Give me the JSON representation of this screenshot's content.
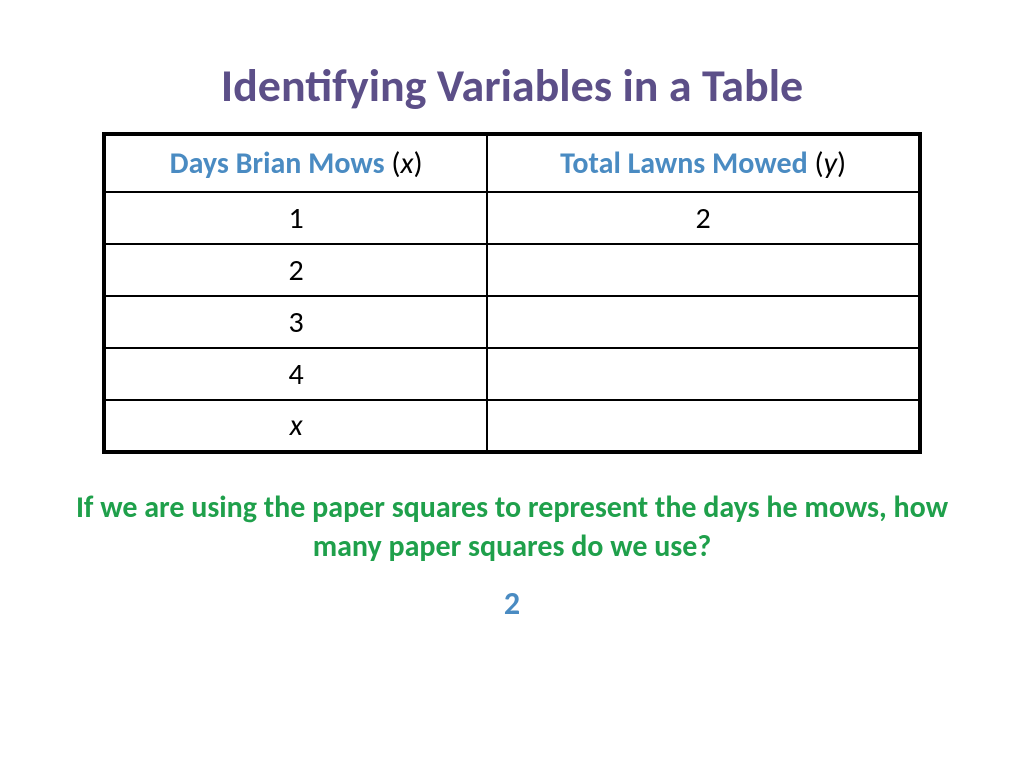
{
  "title": "Identifying Variables in a Table",
  "table": {
    "headers": [
      {
        "label": "Days Brian Mows",
        "var": "x"
      },
      {
        "label": "Total Lawns Mowed",
        "var": "y"
      }
    ],
    "rows": [
      {
        "c0": "1",
        "c1": "2"
      },
      {
        "c0": "2",
        "c1": ""
      },
      {
        "c0": "3",
        "c1": ""
      },
      {
        "c0": "4",
        "c1": ""
      },
      {
        "c0": "x",
        "c1": "",
        "c0_italic": true
      }
    ]
  },
  "question": "If we are using the paper squares to represent the days he mows, how many paper squares do we use?",
  "answer": "2"
}
